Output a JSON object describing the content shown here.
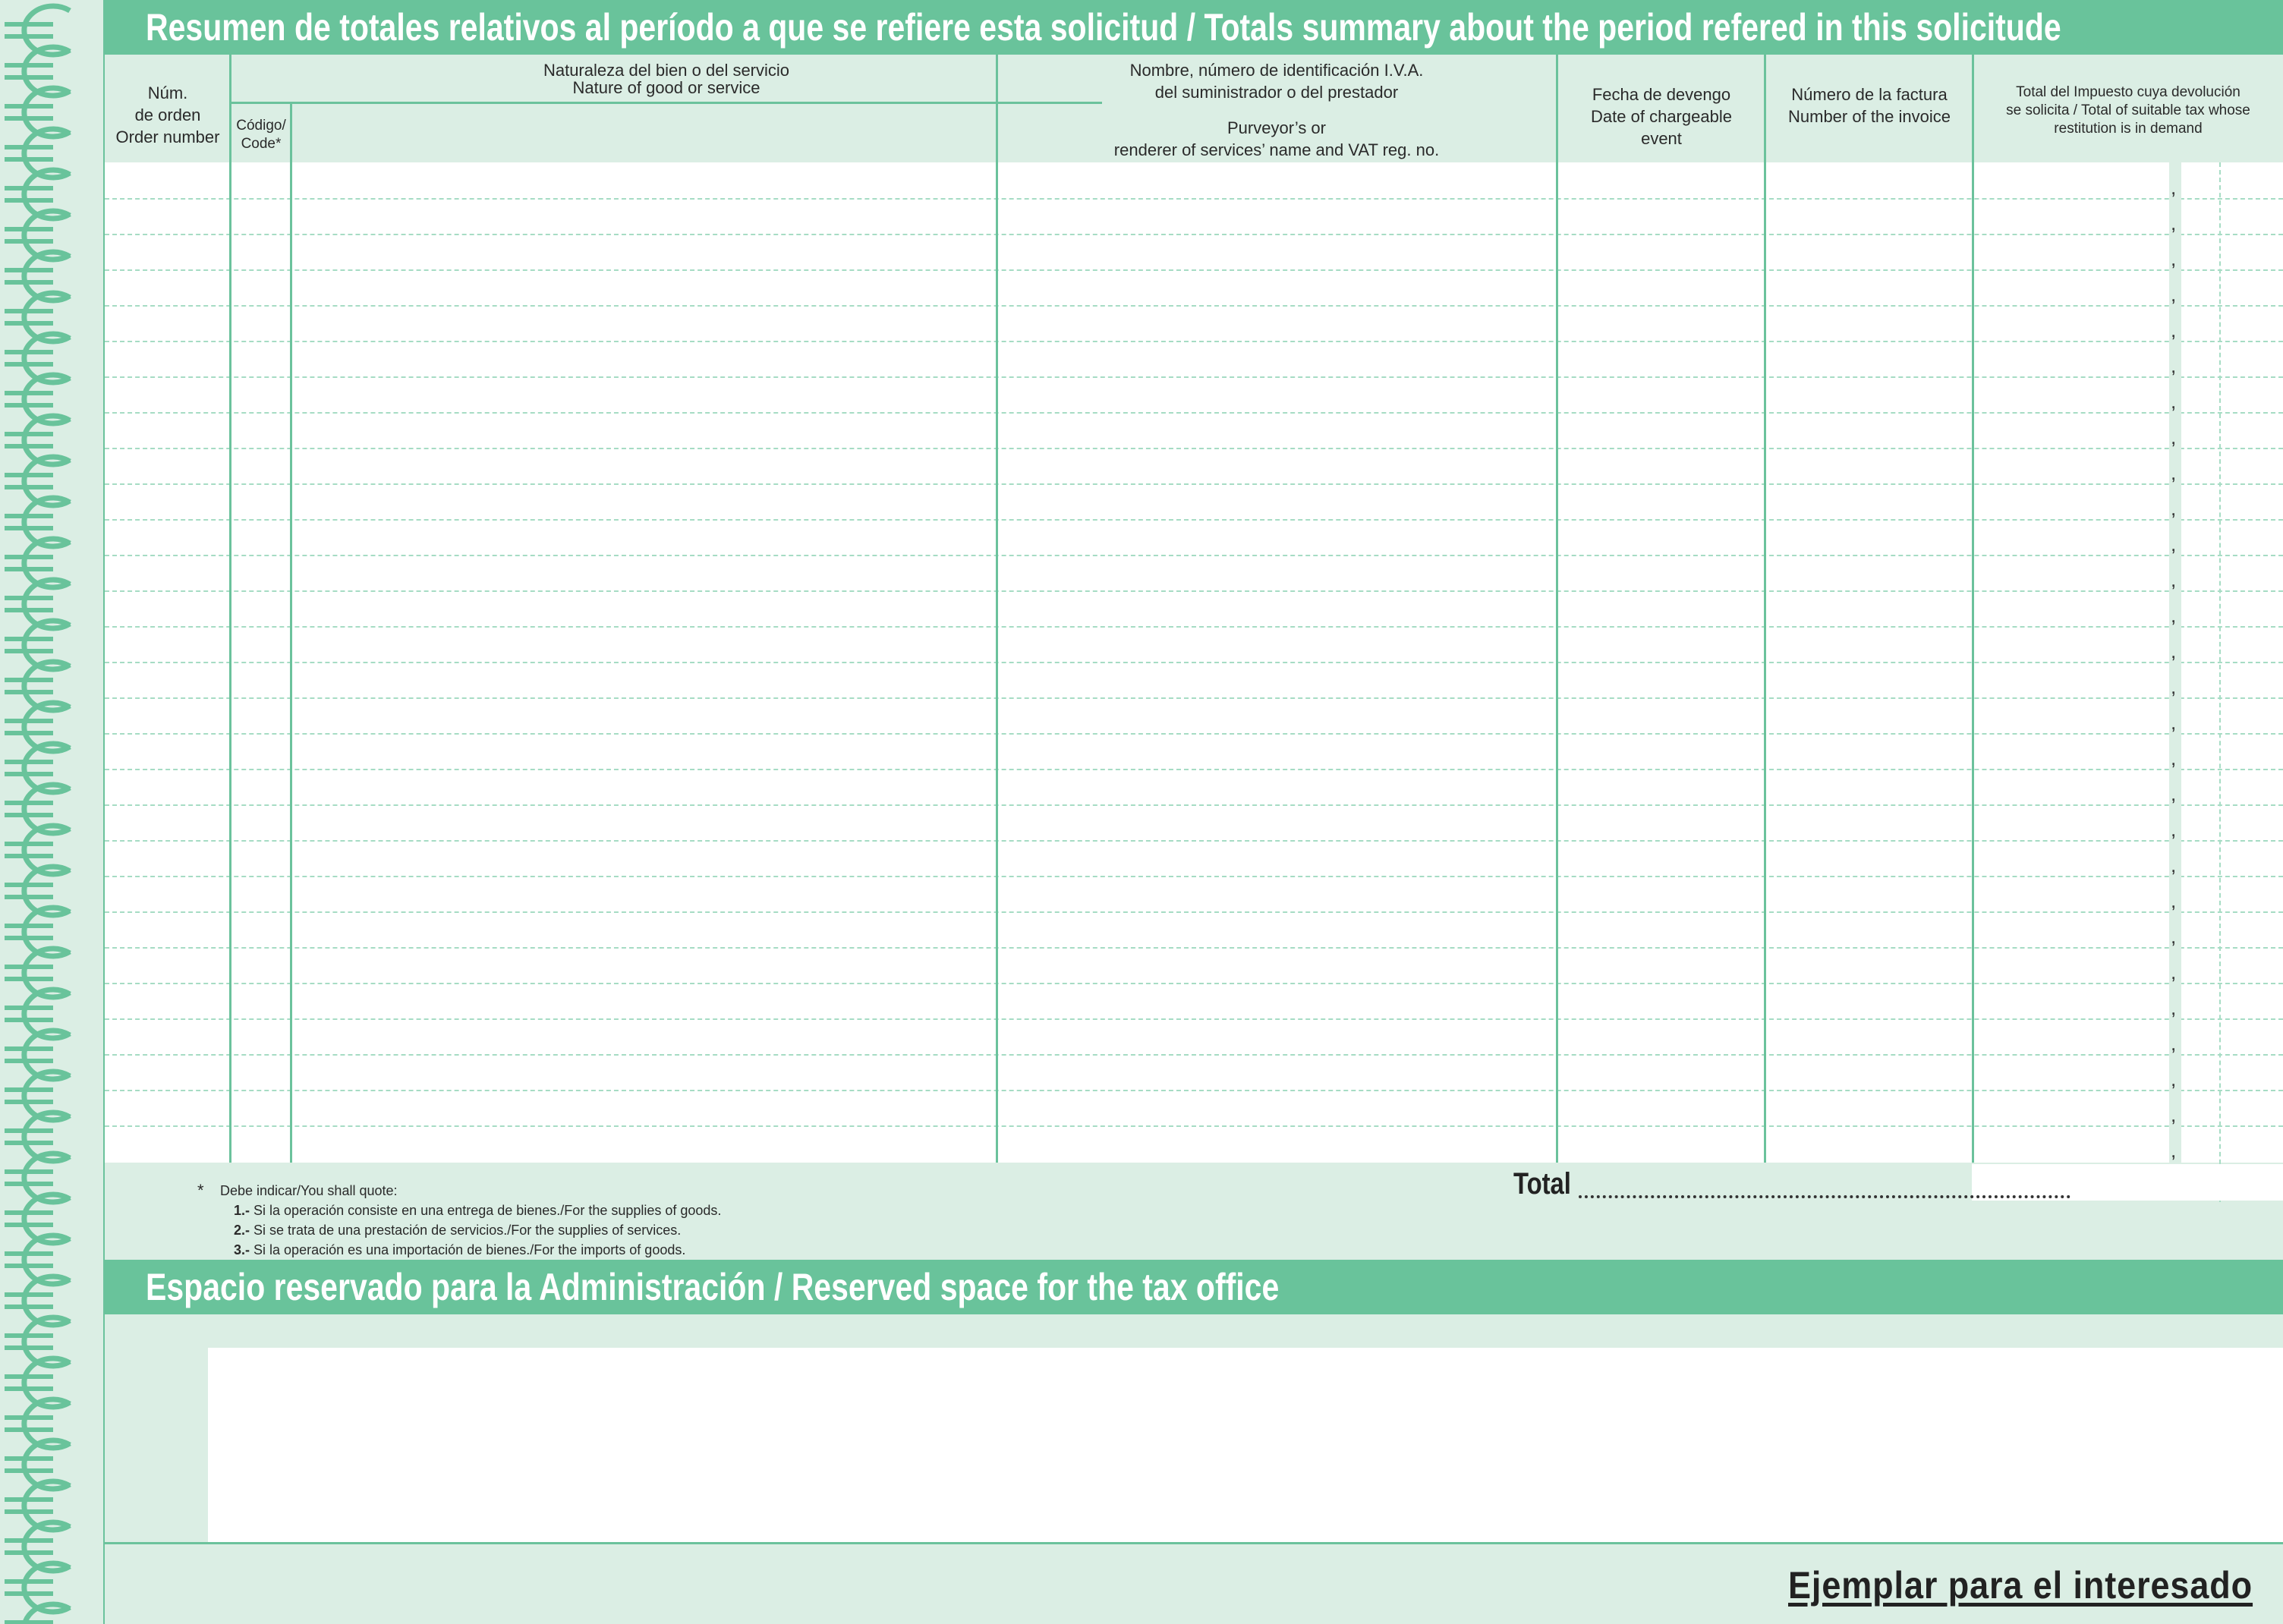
{
  "header": {
    "title": "Resumen de totales relativos al período a que se refiere esta solicitud / Totals summary about the period refered in this solicitude"
  },
  "columns": {
    "order": {
      "line1": "Núm.",
      "line2": "de orden",
      "line3": "Order number"
    },
    "nature": {
      "line1": "Naturaleza del bien o del servicio",
      "line2": "Nature of good or service"
    },
    "code": {
      "line1": "Código/",
      "line2": "Code",
      "star": "*"
    },
    "supplier": {
      "line1": "Nombre, número de identificación I.V.A.",
      "line2": "del suministrador o del prestador",
      "line3": "Purveyor’s or",
      "line4": "renderer of services’ name and VAT reg. no."
    },
    "date": {
      "line1": "Fecha de devengo",
      "line2": "Date of chargeable",
      "line3": "event"
    },
    "invoice": {
      "line1": "Número de la factura",
      "line2": "Number of the invoice"
    },
    "total": {
      "line1": "Total del Impuesto cuya devolución",
      "line2": "se solicita / Total of suitable tax whose",
      "line3": "restitution is in demand"
    }
  },
  "decimal_separator": ",",
  "notes": {
    "star": "*",
    "intro": "Debe indicar/You shall quote:",
    "items": [
      {
        "num": "1.-",
        "text": "Si la operación consiste en una entrega de bienes./For the supplies of goods."
      },
      {
        "num": "2.-",
        "text": "Si se trata de una prestación de servicios./For the supplies of services."
      },
      {
        "num": "3.-",
        "text": "Si la operación es una importación de bienes./For the imports of goods."
      }
    ]
  },
  "total_label": "Total",
  "reserved": {
    "title": "Espacio reservado para la Administración / Reserved space for the tax office"
  },
  "copy_label": "Ejemplar para el interesado",
  "colors": {
    "accent": "#69c39b",
    "light": "#dbeee4",
    "line": "#6bc29c",
    "dash": "#a6dcc4"
  }
}
